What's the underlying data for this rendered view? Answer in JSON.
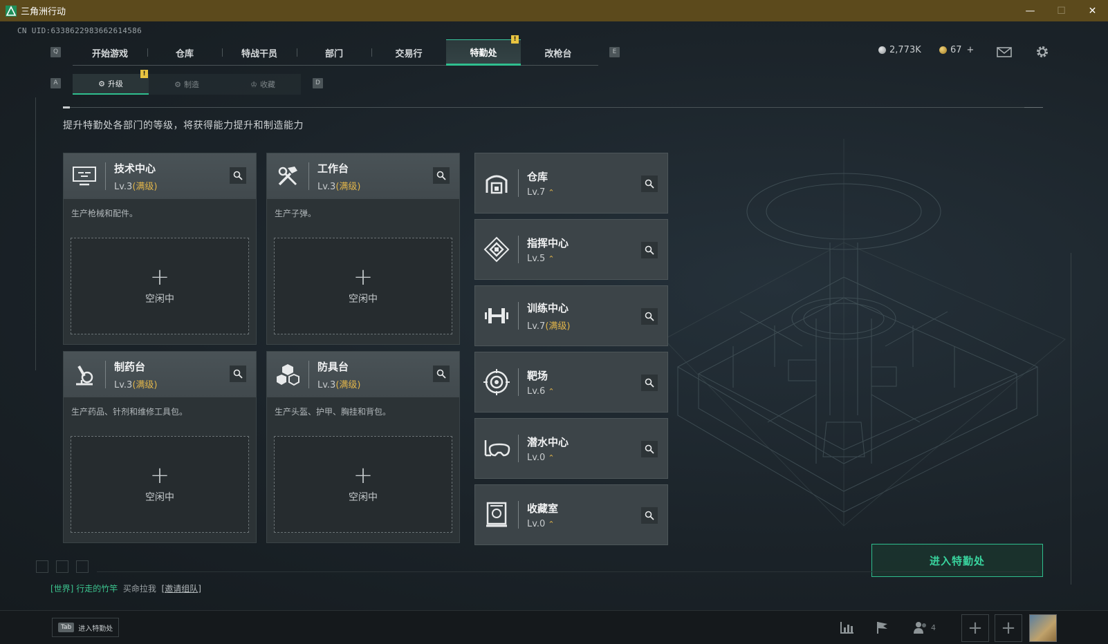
{
  "window": {
    "title": "三角洲行动",
    "minimize": "—",
    "maximize": "☐",
    "close": "✕"
  },
  "uid": "CN UID:6338622983662614586",
  "nav": {
    "left_key": "Q",
    "right_key": "E",
    "items": [
      {
        "label": "开始游戏"
      },
      {
        "label": "仓库"
      },
      {
        "label": "特战干员"
      },
      {
        "label": "部门"
      },
      {
        "label": "交易行"
      },
      {
        "label": "特勤处",
        "active": true
      },
      {
        "label": "改枪台"
      }
    ],
    "alert": "!"
  },
  "currency": {
    "hafu_coin": "2,773K",
    "tickets": "67",
    "add": "+"
  },
  "subtabs": {
    "left_key": "A",
    "right_key": "D",
    "items": [
      {
        "label": "升级",
        "active": true
      },
      {
        "label": "制造"
      },
      {
        "label": "收藏"
      }
    ],
    "alert": "!"
  },
  "description": "提升特勤处各部门的等级，将获得能力提升和制造能力",
  "production_cards": [
    {
      "name": "技术中心",
      "level": "Lv.3",
      "max": "(满级)",
      "desc": "生产枪械和配件。",
      "slot_plus": "+",
      "slot_status": "空闲中"
    },
    {
      "name": "工作台",
      "level": "Lv.3",
      "max": "(满级)",
      "desc": "生产子弹。",
      "slot_plus": "+",
      "slot_status": "空闲中"
    },
    {
      "name": "制药台",
      "level": "Lv.3",
      "max": "(满级)",
      "desc": "生产药品、针剂和维修工具包。",
      "slot_plus": "+",
      "slot_status": "空闲中"
    },
    {
      "name": "防具台",
      "level": "Lv.3",
      "max": "(满级)",
      "desc": "生产头盔、护甲、胸挂和背包。",
      "slot_plus": "+",
      "slot_status": "空闲中"
    }
  ],
  "facility_cards": [
    {
      "name": "仓库",
      "level": "Lv.7",
      "upgrade": "⌃"
    },
    {
      "name": "指挥中心",
      "level": "Lv.5",
      "upgrade": "⌃"
    },
    {
      "name": "训练中心",
      "level": "Lv.7",
      "max": "(满级)"
    },
    {
      "name": "靶场",
      "level": "Lv.6",
      "upgrade": "⌃"
    },
    {
      "name": "潜水中心",
      "level": "Lv.0",
      "upgrade": "⌃"
    },
    {
      "name": "收藏室",
      "level": "Lv.0",
      "upgrade": "⌃"
    }
  ],
  "enter_button": "进入特勤处",
  "chat": {
    "channel": "[世界]",
    "user": "行走的竹竿",
    "message": "买命拉我",
    "link": "[邀请组队]"
  },
  "bottom": {
    "tab_key": "Tab",
    "tab_label": "进入特勤处",
    "friends_count": "4"
  },
  "colors": {
    "accent": "#2fbf8f",
    "gold": "#e1b54a",
    "titlebar": "#5c4a1c"
  }
}
